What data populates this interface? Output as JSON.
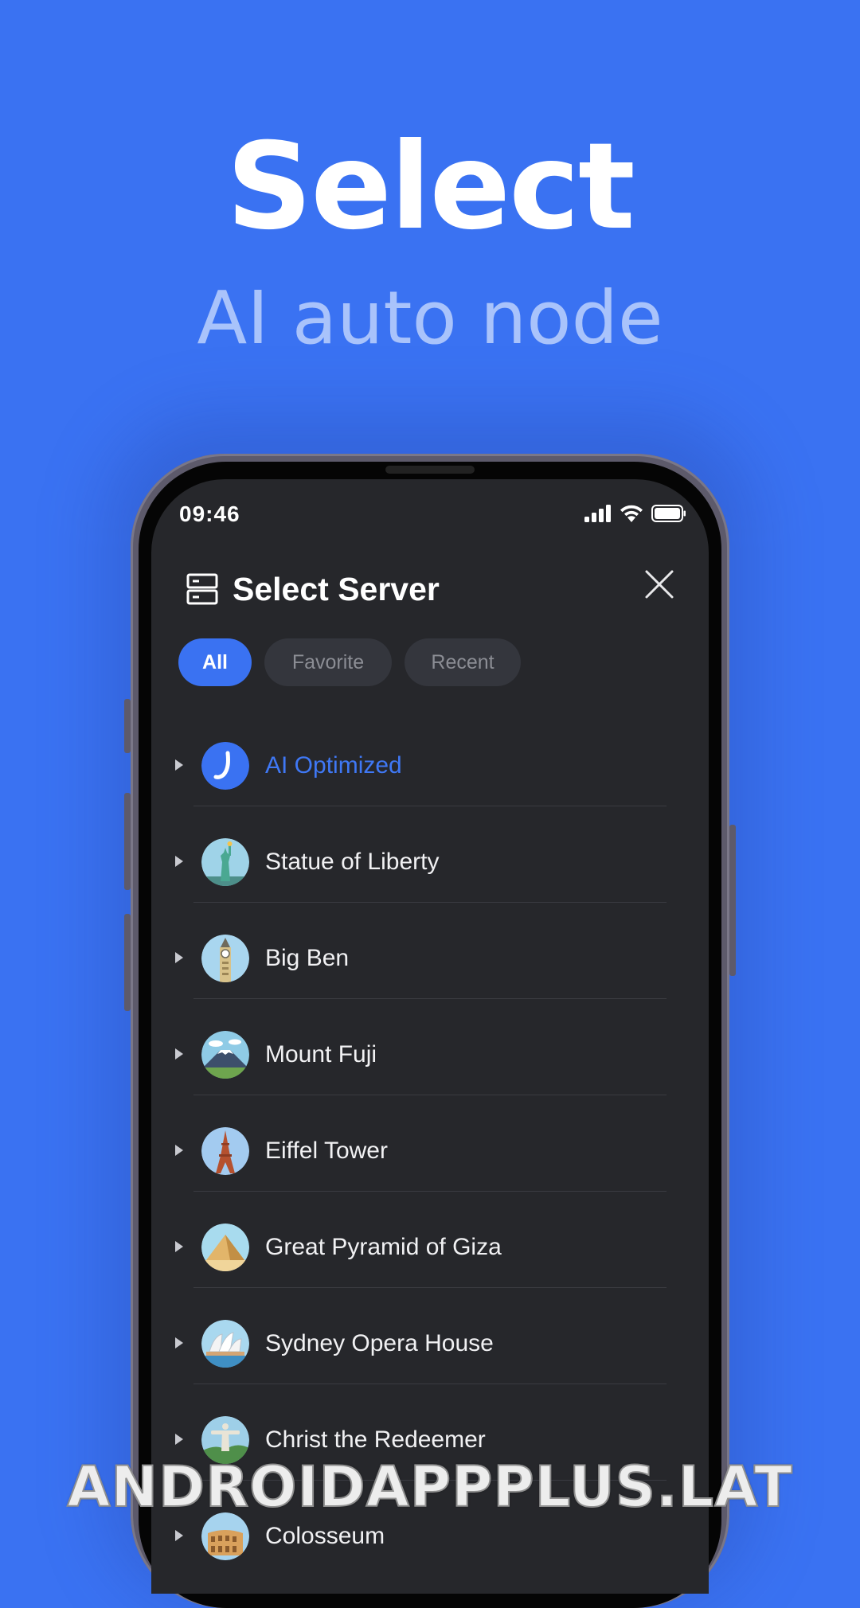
{
  "hero": {
    "title": "Select",
    "subtitle": "AI auto node"
  },
  "status_bar": {
    "time": "09:46"
  },
  "header": {
    "title": "Select Server",
    "icon": "server-icon"
  },
  "tabs": [
    {
      "label": "All",
      "active": true
    },
    {
      "label": "Favorite",
      "active": false
    },
    {
      "label": "Recent",
      "active": false
    }
  ],
  "servers": [
    {
      "label": "AI Optimized",
      "icon": "ai-logo-icon",
      "highlighted": true
    },
    {
      "label": "Statue of Liberty",
      "icon": "statue-of-liberty-icon",
      "highlighted": false
    },
    {
      "label": "Big Ben",
      "icon": "big-ben-icon",
      "highlighted": false
    },
    {
      "label": "Mount Fuji",
      "icon": "mount-fuji-icon",
      "highlighted": false
    },
    {
      "label": "Eiffel Tower",
      "icon": "eiffel-tower-icon",
      "highlighted": false
    },
    {
      "label": "Great Pyramid of Giza",
      "icon": "pyramid-icon",
      "highlighted": false
    },
    {
      "label": "Sydney Opera House",
      "icon": "opera-house-icon",
      "highlighted": false
    },
    {
      "label": "Christ the Redeemer",
      "icon": "christ-redeemer-icon",
      "highlighted": false
    },
    {
      "label": "Colosseum",
      "icon": "colosseum-icon",
      "highlighted": false
    }
  ],
  "watermark": "ANDROIDAPPPLUS.LAT",
  "colors": {
    "background": "#3a72f2",
    "accent": "#3a72f2",
    "screen": "#26272b",
    "subtitle": "#a9c3fb"
  }
}
